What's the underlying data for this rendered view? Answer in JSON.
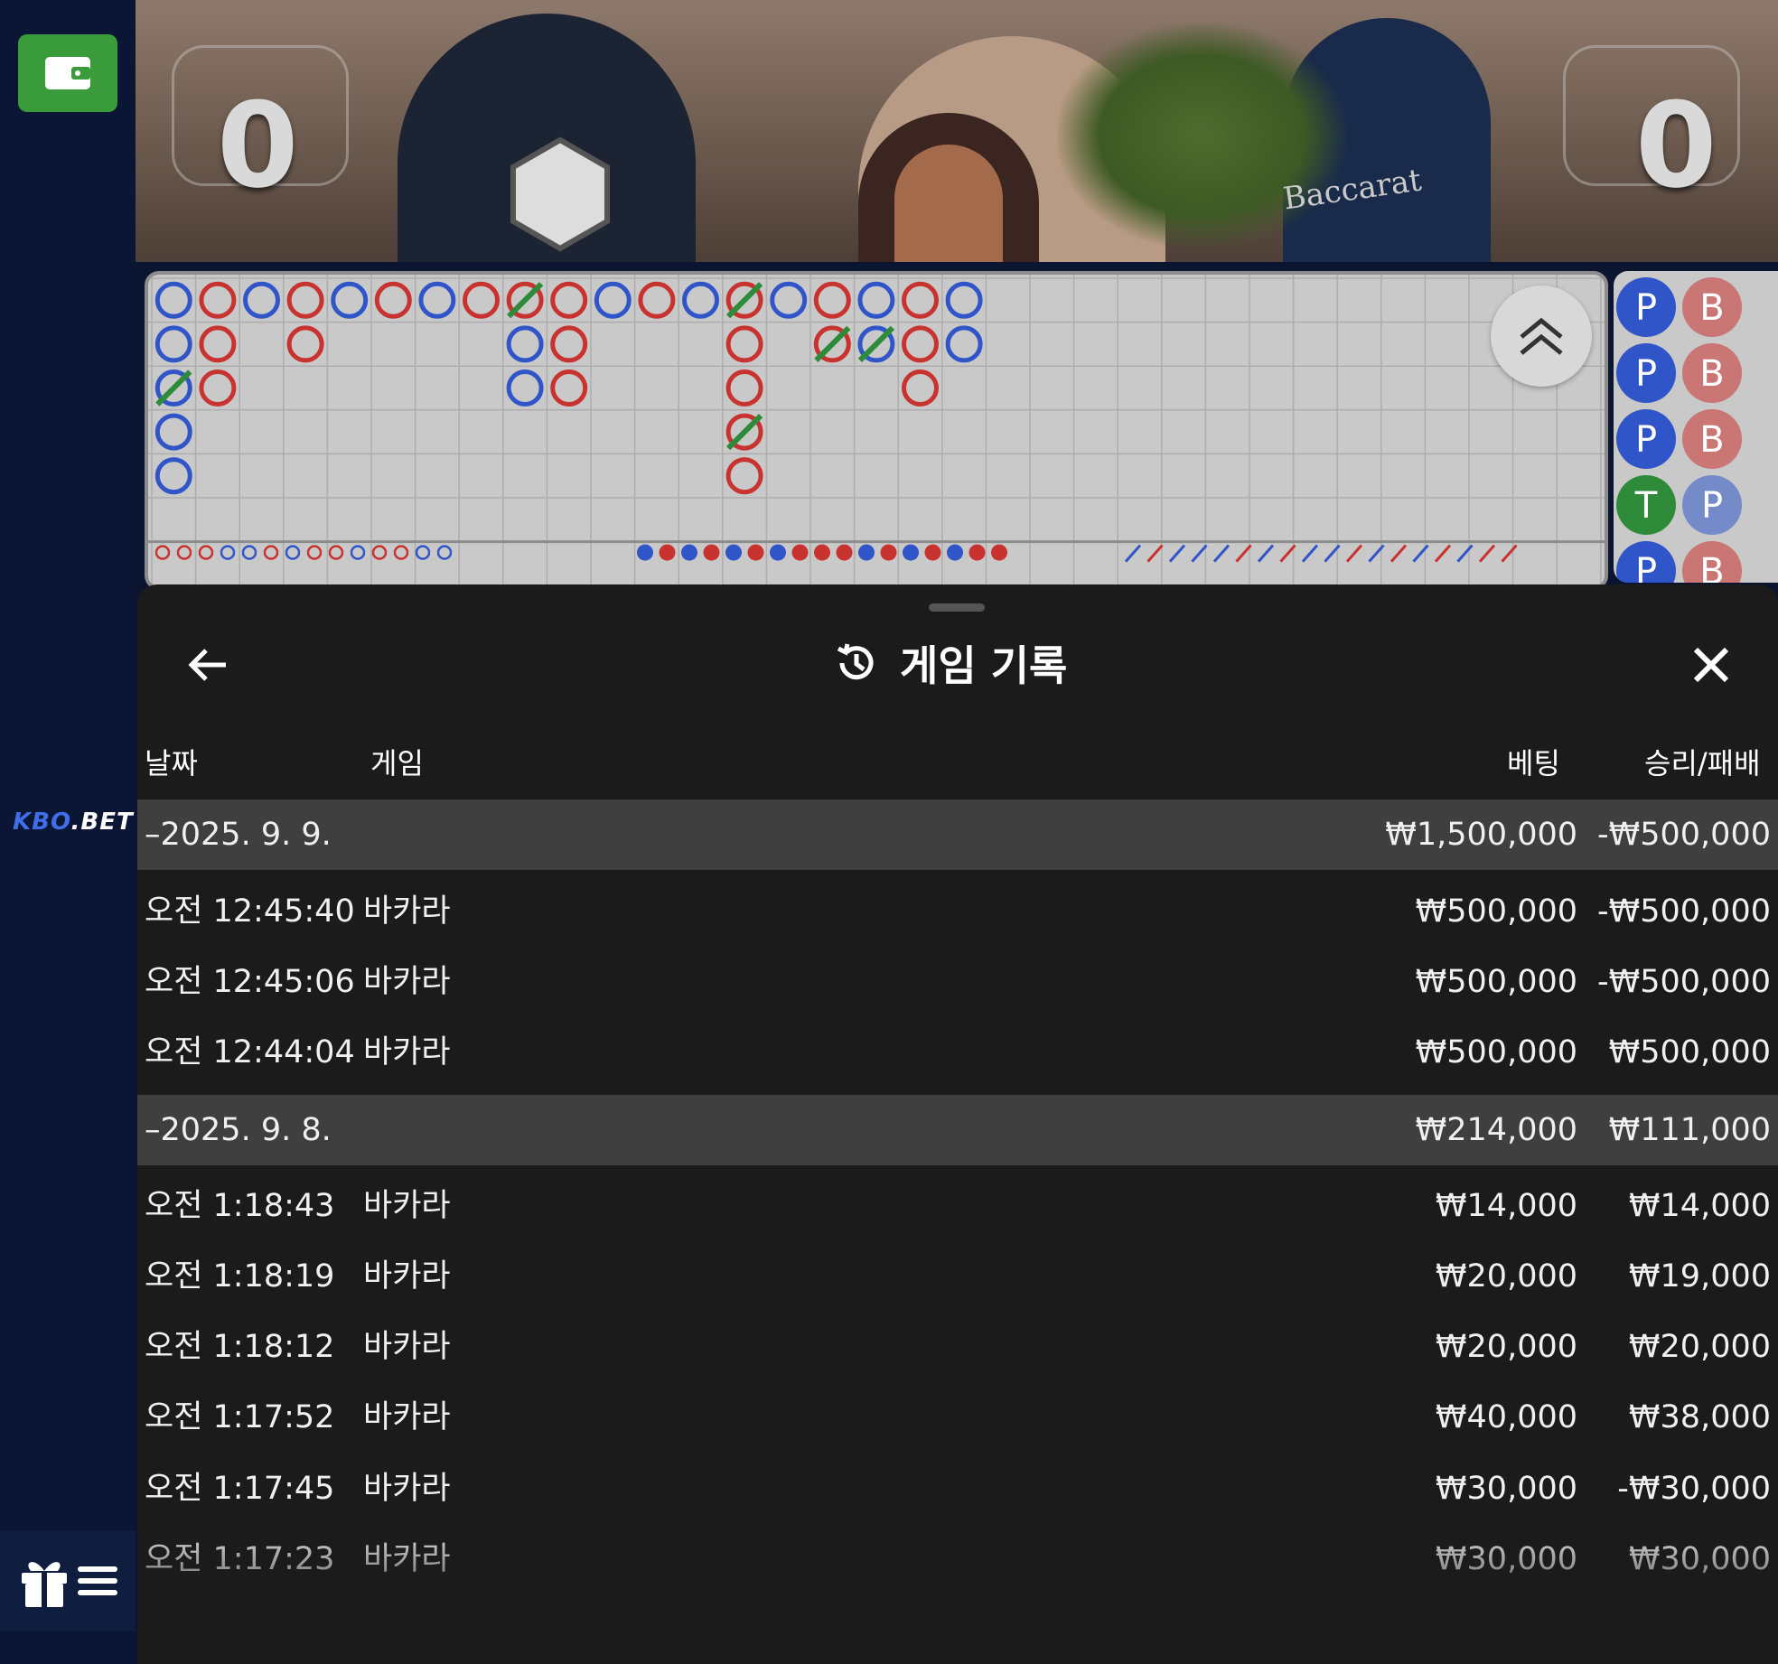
{
  "video": {
    "player_score": "0",
    "banker_score": "0",
    "sign_text": "Baccarat"
  },
  "brand": {
    "logo_part1": "KBO",
    "logo_part2": ".BET"
  },
  "colors": {
    "player": "#2f55c8",
    "banker": "#c8322f",
    "tie": "#2e8b3a",
    "wallet": "#3a9b3a"
  },
  "roadmap": {
    "big_road_columns": [
      [
        "P",
        "P",
        "P*",
        "P",
        "P"
      ],
      [
        "B",
        "B",
        "B"
      ],
      [
        "P"
      ],
      [
        "B",
        "B"
      ],
      [
        "P"
      ],
      [
        "B"
      ],
      [
        "P"
      ],
      [
        "B"
      ],
      [
        "B*",
        "P",
        "P"
      ],
      [
        "B",
        "B",
        "B"
      ],
      [
        "P"
      ],
      [
        "B"
      ],
      [
        "P"
      ],
      [
        "B*",
        "B",
        "B",
        "B*",
        "B"
      ],
      [
        "P"
      ],
      [
        "B",
        "B*"
      ],
      [
        "P",
        "P*"
      ],
      [
        "B",
        "B",
        "B"
      ],
      [
        "P",
        "P"
      ]
    ],
    "side_road": [
      [
        "P",
        "B"
      ],
      [
        "P",
        "B"
      ],
      [
        "P",
        "B"
      ],
      [
        "T",
        "P"
      ],
      [
        "P",
        "B"
      ]
    ]
  },
  "history": {
    "title": "게임 기록",
    "columns": {
      "date": "날짜",
      "game": "게임",
      "bet": "베팅",
      "result": "승리/패배"
    },
    "rows": [
      {
        "type": "date",
        "date": "–2025. 9. 9.",
        "bet": "₩1,500,000",
        "result": "-₩500,000"
      },
      {
        "type": "entry",
        "time": "오전 12:45:40",
        "game": "바카라",
        "bet": "₩500,000",
        "result": "-₩500,000"
      },
      {
        "type": "entry",
        "time": "오전 12:45:06",
        "game": "바카라",
        "bet": "₩500,000",
        "result": "-₩500,000"
      },
      {
        "type": "entry",
        "time": "오전 12:44:04",
        "game": "바카라",
        "bet": "₩500,000",
        "result": "₩500,000"
      },
      {
        "type": "date",
        "date": "–2025. 9. 8.",
        "bet": "₩214,000",
        "result": "₩111,000"
      },
      {
        "type": "entry",
        "time": "오전 1:18:43",
        "game": "바카라",
        "bet": "₩14,000",
        "result": "₩14,000"
      },
      {
        "type": "entry",
        "time": "오전 1:18:19",
        "game": "바카라",
        "bet": "₩20,000",
        "result": "₩19,000"
      },
      {
        "type": "entry",
        "time": "오전 1:18:12",
        "game": "바카라",
        "bet": "₩20,000",
        "result": "₩20,000"
      },
      {
        "type": "entry",
        "time": "오전 1:17:52",
        "game": "바카라",
        "bet": "₩40,000",
        "result": "₩38,000"
      },
      {
        "type": "entry",
        "time": "오전 1:17:45",
        "game": "바카라",
        "bet": "₩30,000",
        "result": "-₩30,000"
      },
      {
        "type": "entry",
        "time": "오전 1:17:23",
        "game": "바카라",
        "bet": "₩30,000",
        "result": "₩30,000"
      }
    ]
  }
}
